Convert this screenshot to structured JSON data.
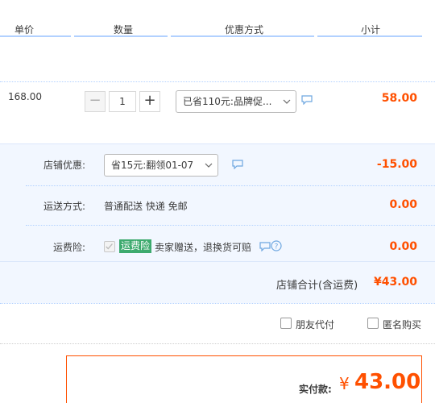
{
  "header": {
    "col_price": "单价",
    "col_qty": "数量",
    "col_promo": "优惠方式",
    "col_subtotal": "小计"
  },
  "item": {
    "unit_price": "168.00",
    "quantity": "1",
    "minus_label": "−",
    "plus_label": "+",
    "promo_select": "已省110元:品牌促...",
    "subtotal": "58.00"
  },
  "shop": {
    "discount_label": "店铺优惠:",
    "discount_select": "省15元:翻领01-07",
    "discount_amount": "-15.00",
    "shipping_label": "运送方式:",
    "shipping_value": "普通配送 快递 免邮",
    "shipping_amount": "0.00",
    "insurance_label": "运费险:",
    "insurance_tag": "运费险",
    "insurance_desc": "卖家赠送，退换货可赔",
    "insurance_amount": "0.00",
    "total_label": "店铺合计(含运费)",
    "total_amount": "¥43.00"
  },
  "options": {
    "friend_pay": "朋友代付",
    "anonymous": "匿名购买"
  },
  "payment": {
    "label": "实付款:",
    "currency": "¥",
    "amount": "43.00"
  },
  "colors": {
    "accent": "#ff5000",
    "header_line": "#b2d1ff",
    "row_bg": "#f2f7ff",
    "tag_green": "#3daa6e",
    "icon_blue": "#6ea7e0"
  }
}
